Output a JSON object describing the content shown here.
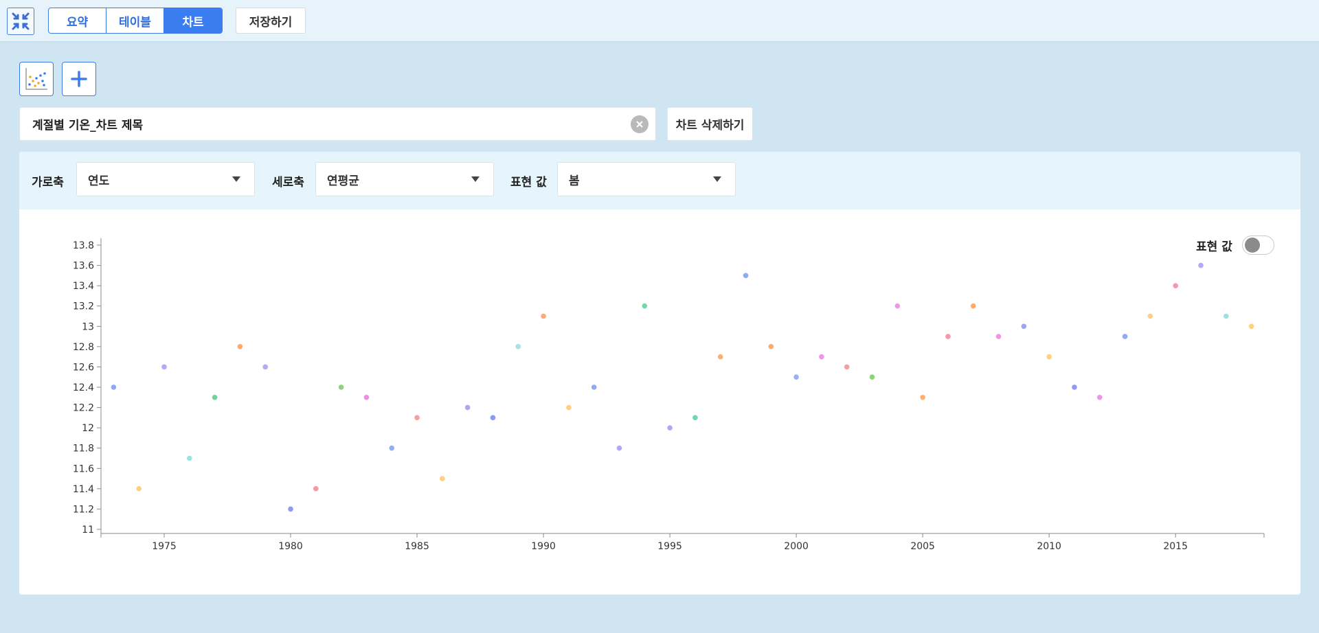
{
  "header": {
    "collapse_icon": "collapse-arrows-icon",
    "tabs": [
      {
        "label": "요약",
        "active": false
      },
      {
        "label": "테이블",
        "active": false
      },
      {
        "label": "차트",
        "active": true
      }
    ],
    "save_label": "저장하기"
  },
  "toolbar": {
    "scatter_icon": "scatter-chart-icon",
    "add_icon": "plus-icon"
  },
  "title_field": {
    "value": "계절별 기온_차트 제목",
    "clear_icon": "close-icon"
  },
  "delete_label": "차트 삭제하기",
  "filters": {
    "x_axis": {
      "label": "가로축",
      "value": "연도"
    },
    "y_axis": {
      "label": "세로축",
      "value": "연평균"
    },
    "display_value": {
      "label": "표현 값",
      "value": "봄"
    }
  },
  "legend_toggle": {
    "label": "표현 값",
    "on": false
  },
  "chart_data": {
    "type": "scatter",
    "title": "",
    "xlabel": "",
    "ylabel": "",
    "xlim": [
      1972.5,
      2018.5
    ],
    "ylim": [
      11,
      13.8
    ],
    "x_ticks": [
      1975,
      1980,
      1985,
      1990,
      1995,
      2000,
      2005,
      2010,
      2015
    ],
    "y_ticks": [
      11,
      11.2,
      11.4,
      11.6,
      11.8,
      12,
      12.2,
      12.4,
      12.6,
      12.8,
      13,
      13.2,
      13.4,
      13.6,
      13.8
    ],
    "grid": false,
    "point_colors": [
      "#7fa3f5",
      "#ffc97a",
      "#b8a8f7",
      "#8ee0e0",
      "#6fd8a4",
      "#ffab70",
      "#a8b3f7",
      "#f39ab0",
      "#ee95e6",
      "#8fd68a"
    ],
    "points": [
      {
        "x": 1973,
        "y": 12.4,
        "color": "#8fa8f2"
      },
      {
        "x": 1974,
        "y": 11.4,
        "color": "#ffcf80"
      },
      {
        "x": 1975,
        "y": 12.6,
        "color": "#b9a6f7"
      },
      {
        "x": 1976,
        "y": 11.7,
        "color": "#9be3e3"
      },
      {
        "x": 1977,
        "y": 12.3,
        "color": "#6fd3a0"
      },
      {
        "x": 1978,
        "y": 12.8,
        "color": "#ffab6b"
      },
      {
        "x": 1979,
        "y": 12.6,
        "color": "#b9a6f7"
      },
      {
        "x": 1980,
        "y": 11.2,
        "color": "#8f9af2"
      },
      {
        "x": 1981,
        "y": 11.4,
        "color": "#f39aa8"
      },
      {
        "x": 1982,
        "y": 12.4,
        "color": "#8fd27a"
      },
      {
        "x": 1983,
        "y": 12.3,
        "color": "#e990e0"
      },
      {
        "x": 1984,
        "y": 11.8,
        "color": "#8fb0f2"
      },
      {
        "x": 1985,
        "y": 12.1,
        "color": "#f5a09a"
      },
      {
        "x": 1986,
        "y": 11.5,
        "color": "#ffd080"
      },
      {
        "x": 1987,
        "y": 12.2,
        "color": "#b0a6f2"
      },
      {
        "x": 1988,
        "y": 12.1,
        "color": "#8a9af2"
      },
      {
        "x": 1989,
        "y": 12.8,
        "color": "#a6e3e3"
      },
      {
        "x": 1990,
        "y": 13.1,
        "color": "#ffa878"
      },
      {
        "x": 1991,
        "y": 12.2,
        "color": "#ffd080"
      },
      {
        "x": 1992,
        "y": 12.4,
        "color": "#8faaf2"
      },
      {
        "x": 1993,
        "y": 11.8,
        "color": "#b4a6f5"
      },
      {
        "x": 1994,
        "y": 13.2,
        "color": "#6fd8a4"
      },
      {
        "x": 1995,
        "y": 12.0,
        "color": "#b4a6f5"
      },
      {
        "x": 1996,
        "y": 12.1,
        "color": "#6fd8b0"
      },
      {
        "x": 1997,
        "y": 12.7,
        "color": "#ffb070"
      },
      {
        "x": 1998,
        "y": 13.5,
        "color": "#8faaf2"
      },
      {
        "x": 1999,
        "y": 12.8,
        "color": "#ffab6b"
      },
      {
        "x": 2000,
        "y": 12.5,
        "color": "#9ab0f2"
      },
      {
        "x": 2001,
        "y": 12.7,
        "color": "#ee95e6"
      },
      {
        "x": 2002,
        "y": 12.6,
        "color": "#f5a0a0"
      },
      {
        "x": 2003,
        "y": 12.5,
        "color": "#8fd27a"
      },
      {
        "x": 2004,
        "y": 13.2,
        "color": "#ee95e6"
      },
      {
        "x": 2005,
        "y": 12.3,
        "color": "#ffb070"
      },
      {
        "x": 2006,
        "y": 12.9,
        "color": "#f598a8"
      },
      {
        "x": 2007,
        "y": 13.2,
        "color": "#ffab6b"
      },
      {
        "x": 2008,
        "y": 12.9,
        "color": "#ee95e6"
      },
      {
        "x": 2009,
        "y": 13.0,
        "color": "#9aa8f2"
      },
      {
        "x": 2010,
        "y": 12.7,
        "color": "#ffd080"
      },
      {
        "x": 2011,
        "y": 12.4,
        "color": "#8f9af2"
      },
      {
        "x": 2012,
        "y": 12.3,
        "color": "#ee95e6"
      },
      {
        "x": 2013,
        "y": 12.9,
        "color": "#8faaf2"
      },
      {
        "x": 2014,
        "y": 13.1,
        "color": "#ffd080"
      },
      {
        "x": 2015,
        "y": 13.4,
        "color": "#f598a8"
      },
      {
        "x": 2016,
        "y": 13.6,
        "color": "#b9a6f7"
      },
      {
        "x": 2017,
        "y": 13.1,
        "color": "#9be3e3"
      },
      {
        "x": 2018,
        "y": 13.0,
        "color": "#ffd080"
      }
    ]
  }
}
